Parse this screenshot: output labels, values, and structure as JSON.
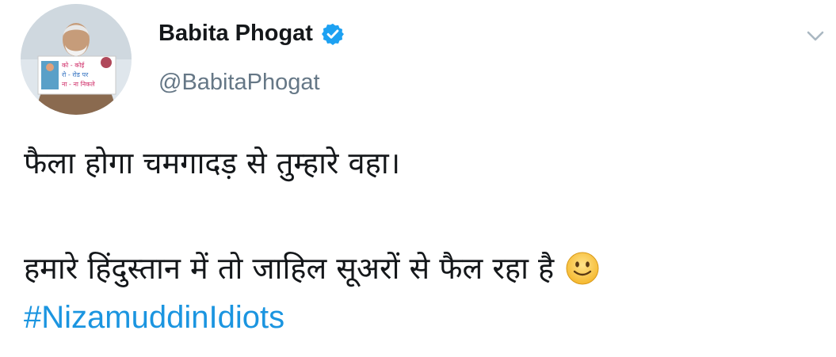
{
  "author": {
    "display_name": "Babita Phogat",
    "username": "@BabitaPhogat",
    "verified": true,
    "avatar_sign_text": [
      "को - कोई",
      "रो - रोड पर",
      "ना - ना निकले"
    ]
  },
  "tweet": {
    "line_1": "फैला होगा चमगादड़ से तुम्हारे वहा।",
    "line_2": "हमारे हिंदुस्तान में तो जाहिल सूअरों से फैल रहा है",
    "hashtag": "#NizamuddinIdiots"
  },
  "icons": {
    "verified": "verified-badge-icon",
    "menu": "chevron-down-icon",
    "emoji": "slightly-smiling-face-icon"
  },
  "colors": {
    "text": "#14171a",
    "secondary": "#657786",
    "link": "#1b95e0",
    "verified": "#1da1f2",
    "chevron": "#aab8c2"
  }
}
